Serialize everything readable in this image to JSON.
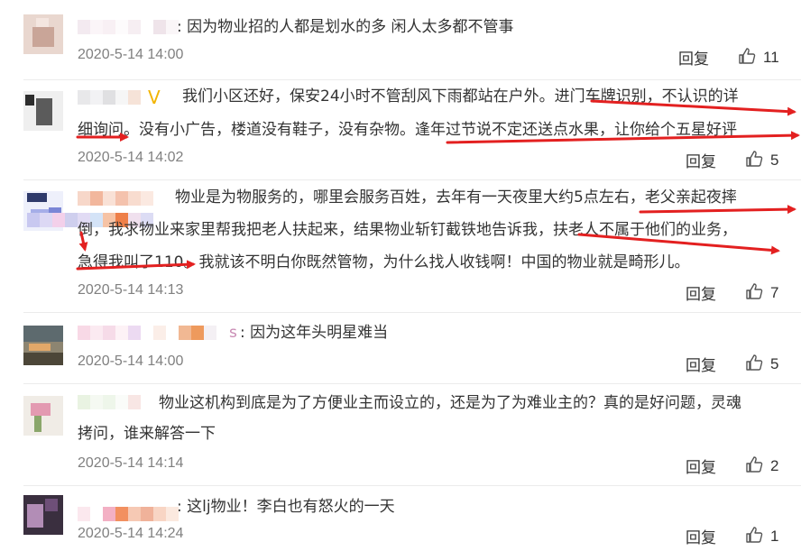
{
  "colors": {
    "annotation_red": "#e32020",
    "timestamp": "#808080",
    "divider": "#ebebeb"
  },
  "reply_label": "回复",
  "like_icon": "thumbs-up-icon",
  "comments": [
    {
      "text_lines": [
        ":  因为物业招的人都是划水的多 闲人太多都不管事"
      ],
      "time": "2020-5-14 14:00",
      "likes": "11"
    },
    {
      "text_lines": [
        "我们小区还好，保安24小时不管刮风下雨都站在户外。进门车牌识别，不认识的详",
        "细询问。没有小广告，楼道没有鞋子，没有杂物。逢年过节说不定还送点水果，让你给个五星好评"
      ],
      "time": "2020-5-14 14:02",
      "likes": "5"
    },
    {
      "text_lines": [
        "物业是为物服务的，哪里会服务百姓，去年有一天夜里大约5点左右，老父亲起夜摔",
        "倒，我求物业来家里帮我把老人扶起来，结果物业斩钉截铁地告诉我，扶老人不属于他们的业务，",
        "急得我叫了110。我就该不明白你既然管物，为什么找人收钱啊！中国的物业就是畸形儿。"
      ],
      "time": "2020-5-14 14:13",
      "likes": "7"
    },
    {
      "name_tail": "s",
      "text_lines": [
        ":  因为这年头明星难当"
      ],
      "time": "2020-5-14 14:00",
      "likes": "5"
    },
    {
      "text_lines": [
        "物业这机构到底是为了方便业主而设立的，还是为了为难业主的？真的是好问题，灵魂",
        "拷问，谁来解答一下"
      ],
      "time": "2020-5-14 14:14",
      "likes": "2"
    },
    {
      "text_lines": [
        ":  这lj物业！李白也有怒火的一天"
      ],
      "time": "2020-5-14 14:24",
      "likes": "1"
    }
  ]
}
